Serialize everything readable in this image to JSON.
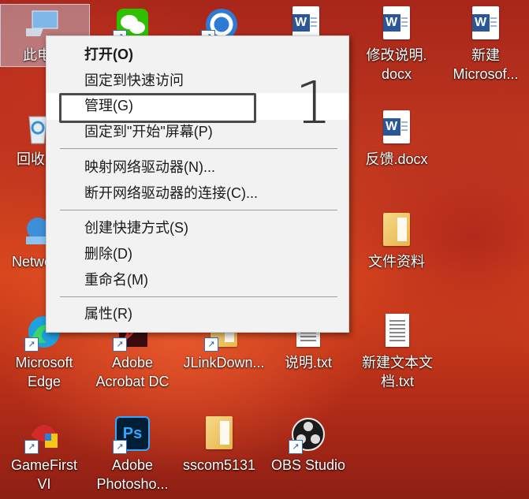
{
  "desktop": {
    "icons": {
      "this_pc": "此电脑",
      "recycle": "回收站",
      "network": "Network",
      "edge_1": "Microsoft",
      "edge_2": "Edge",
      "gamefirst_1": "GameFirst",
      "gamefirst_2": "VI",
      "acrobat_1": "Adobe",
      "acrobat_2": "Acrobat DC",
      "photoshop_1": "Adobe",
      "photoshop_2": "Photosho...",
      "jlink": "JLinkDown...",
      "sscom": "sscom5131",
      "readme": "说明.txt",
      "obs": "OBS Studio",
      "doc_modify_1": "修改说明.",
      "doc_modify_2": "docx",
      "doc_new_1": "新建",
      "doc_new_2": "Microsof...",
      "feedback": "反馈.docx",
      "folder_files": "文件资料",
      "newtxt_1": "新建文本文",
      "newtxt_2": "档.txt"
    }
  },
  "context_menu": {
    "open": "打开(O)",
    "pin_quick": "固定到快速访问",
    "manage": "管理(G)",
    "pin_start": "固定到\"开始\"屏幕(P)",
    "map_drive": "映射网络驱动器(N)...",
    "disconnect_drive": "断开网络驱动器的连接(C)...",
    "create_shortcut": "创建快捷方式(S)",
    "delete": "删除(D)",
    "rename": "重命名(M)",
    "properties": "属性(R)"
  },
  "annotation": {
    "step": "1"
  },
  "icons": {
    "word": "W",
    "photoshop": "Ps",
    "shortcut_arrow": "↗"
  }
}
